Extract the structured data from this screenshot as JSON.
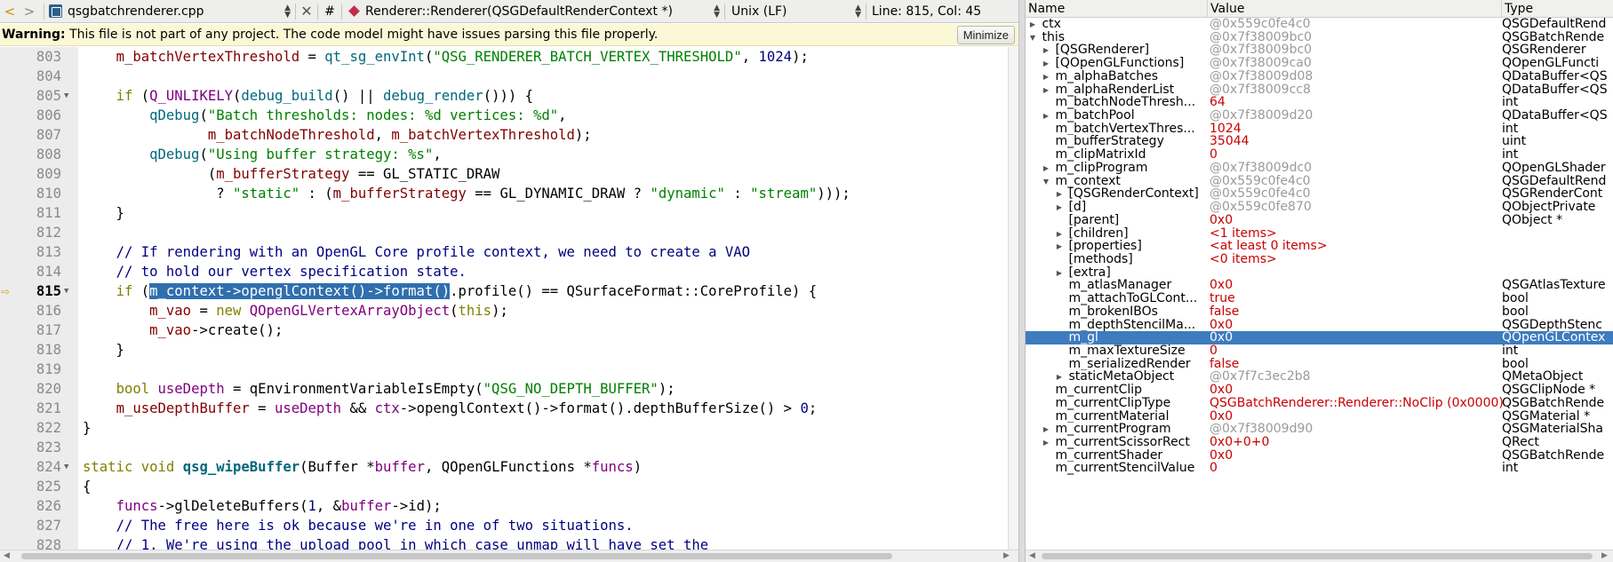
{
  "toolbar": {
    "back_glyph": "<",
    "forward_glyph": ">",
    "file_name": "qsgbatchrenderer.cpp",
    "close_glyph": "✕",
    "hash": "#",
    "symbol": "Renderer::Renderer(QSGDefaultRenderContext *)",
    "line_endings": "Unix (LF)",
    "position": "Line: 815, Col: 45"
  },
  "warning": {
    "label": "Warning:",
    "message": " This file is not part of any project. The code model might have issues parsing this file properly.",
    "button": "Minimize"
  },
  "code_lines": [
    {
      "num": "803",
      "fold": false,
      "html": "    <span class=\"mem\">m_batchVertexThreshold</span> = <span class=\"fnm\">qt_sg_envInt</span>(<span class=\"str\">\"QSG_RENDERER_BATCH_VERTEX_THRESHOLD\"</span>, <span class=\"num\">1024</span>);"
    },
    {
      "num": "804",
      "fold": false,
      "html": ""
    },
    {
      "num": "805",
      "fold": true,
      "html": "    <span class=\"kw\">if</span> (<span class=\"cls\">Q_UNLIKELY</span>(<span class=\"fnm\">debug_build</span>() || <span class=\"fnm\">debug_render</span>())) {"
    },
    {
      "num": "806",
      "fold": false,
      "html": "        <span class=\"fnm\">qDebug</span>(<span class=\"str\">\"Batch thresholds: nodes: %d vertices: %d\"</span>,"
    },
    {
      "num": "807",
      "fold": false,
      "html": "               <span class=\"mem\">m_batchNodeThreshold</span>, <span class=\"mem\">m_batchVertexThreshold</span>);"
    },
    {
      "num": "808",
      "fold": false,
      "html": "        <span class=\"fnm\">qDebug</span>(<span class=\"str\">\"Using buffer strategy: %s\"</span>,"
    },
    {
      "num": "809",
      "fold": false,
      "html": "               (<span class=\"mem\">m_bufferStrategy</span> == GL_STATIC_DRAW"
    },
    {
      "num": "810",
      "fold": false,
      "html": "                ? <span class=\"str\">\"static\"</span> : (<span class=\"mem\">m_bufferStrategy</span> == GL_DYNAMIC_DRAW ? <span class=\"str\">\"dynamic\"</span> : <span class=\"str\">\"stream\"</span>)));"
    },
    {
      "num": "811",
      "fold": false,
      "html": "    }"
    },
    {
      "num": "812",
      "fold": false,
      "html": ""
    },
    {
      "num": "813",
      "fold": false,
      "html": "    <span class=\"cmt\">// If rendering with an OpenGL Core profile context, we need to create a VAO</span>"
    },
    {
      "num": "814",
      "fold": false,
      "html": "    <span class=\"cmt\">// to hold our vertex specification state.</span>"
    },
    {
      "num": "815",
      "fold": true,
      "current": true,
      "html": "    <span class=\"kw\">if</span> (<span class=\"hl\">m_context-&gt;openglContext()-&gt;format()</span>.profile() == QSurfaceFormat::CoreProfile) {"
    },
    {
      "num": "816",
      "fold": false,
      "html": "        <span class=\"mem\">m_vao</span> = <span class=\"kw\">new</span> <span class=\"cls\">QOpenGLVertexArrayObject</span>(<span class=\"kw\">this</span>);"
    },
    {
      "num": "817",
      "fold": false,
      "html": "        <span class=\"mem\">m_vao</span>-&gt;create();"
    },
    {
      "num": "818",
      "fold": false,
      "html": "    }"
    },
    {
      "num": "819",
      "fold": false,
      "html": ""
    },
    {
      "num": "820",
      "fold": false,
      "html": "    <span class=\"kw\">bool</span> <span class=\"cls\">useDepth</span> = qEnvironmentVariableIsEmpty(<span class=\"str\">\"QSG_NO_DEPTH_BUFFER\"</span>);"
    },
    {
      "num": "821",
      "fold": false,
      "html": "    <span class=\"mem\">m_useDepthBuffer</span> = <span class=\"cls\">useDepth</span> &amp;&amp; <span class=\"cls\">ctx</span>-&gt;openglContext()-&gt;format().depthBufferSize() &gt; <span class=\"num\">0</span>;"
    },
    {
      "num": "822",
      "fold": false,
      "html": "}"
    },
    {
      "num": "823",
      "fold": false,
      "html": ""
    },
    {
      "num": "824",
      "fold": true,
      "html": "<span class=\"kw\">static</span> <span class=\"kw\">void</span> <span class=\"fdef\">qsg_wipeBuffer</span>(Buffer *<span class=\"cls\">buffer</span>, QOpenGLFunctions *<span class=\"cls\">funcs</span>)"
    },
    {
      "num": "825",
      "fold": false,
      "html": "{"
    },
    {
      "num": "826",
      "fold": false,
      "html": "    <span class=\"cls\">funcs</span>-&gt;glDeleteBuffers(<span class=\"num\">1</span>, &amp;<span class=\"cls\">buffer</span>-&gt;id);"
    },
    {
      "num": "827",
      "fold": false,
      "html": "    <span class=\"cmt\">// The free here is ok because we're in one of two situations.</span>"
    },
    {
      "num": "828",
      "fold": false,
      "html": "    <span class=\"cmt\">// 1. We're using the upload pool in which case unmap will have set the</span>"
    }
  ],
  "locals": {
    "columns": [
      "Name",
      "Value",
      "Type"
    ],
    "rows": [
      {
        "indent": 0,
        "exp": "closed",
        "name": "ctx",
        "value": "@0x559c0fe4c0",
        "vc": "gray",
        "type": "QSGDefaultRend"
      },
      {
        "indent": 0,
        "exp": "open",
        "name": "this",
        "value": "@0x7f38009bc0",
        "vc": "gray",
        "type": "QSGBatchRende"
      },
      {
        "indent": 1,
        "exp": "closed",
        "name": "[QSGRenderer]",
        "value": "@0x7f38009bc0",
        "vc": "gray",
        "type": "QSGRenderer"
      },
      {
        "indent": 1,
        "exp": "closed",
        "name": "[QOpenGLFunctions]",
        "value": "@0x7f38009ca0",
        "vc": "gray",
        "type": "QOpenGLFuncti"
      },
      {
        "indent": 1,
        "exp": "closed",
        "name": "m_alphaBatches",
        "value": "@0x7f38009d08",
        "vc": "gray",
        "type": "QDataBuffer<QS"
      },
      {
        "indent": 1,
        "exp": "closed",
        "name": "m_alphaRenderList",
        "value": "@0x7f38009cc8",
        "vc": "gray",
        "type": "QDataBuffer<QS"
      },
      {
        "indent": 1,
        "exp": "none",
        "name": "m_batchNodeThresh...",
        "value": "64",
        "vc": "red",
        "type": "int"
      },
      {
        "indent": 1,
        "exp": "closed",
        "name": "m_batchPool",
        "value": "@0x7f38009d20",
        "vc": "gray",
        "type": "QDataBuffer<QS"
      },
      {
        "indent": 1,
        "exp": "none",
        "name": "m_batchVertexThres...",
        "value": "1024",
        "vc": "red",
        "type": "int"
      },
      {
        "indent": 1,
        "exp": "none",
        "name": "m_bufferStrategy",
        "value": "35044",
        "vc": "red",
        "type": "uint"
      },
      {
        "indent": 1,
        "exp": "none",
        "name": "m_clipMatrixId",
        "value": "0",
        "vc": "red",
        "type": "int"
      },
      {
        "indent": 1,
        "exp": "closed",
        "name": "m_clipProgram",
        "value": "@0x7f38009dc0",
        "vc": "gray",
        "type": "QOpenGLShader"
      },
      {
        "indent": 1,
        "exp": "open",
        "name": "m_context",
        "value": "@0x559c0fe4c0",
        "vc": "gray",
        "type": "QSGDefaultRend"
      },
      {
        "indent": 2,
        "exp": "closed",
        "name": "[QSGRenderContext]",
        "value": "@0x559c0fe4c0",
        "vc": "gray",
        "type": "QSGRenderCont"
      },
      {
        "indent": 2,
        "exp": "closed",
        "name": "[d]",
        "value": "@0x559c0fe870",
        "vc": "gray",
        "type": "QObjectPrivate"
      },
      {
        "indent": 2,
        "exp": "none",
        "name": "[parent]",
        "value": "0x0",
        "vc": "red",
        "type": "QObject *"
      },
      {
        "indent": 2,
        "exp": "closed",
        "name": "[children]",
        "value": "<1 items>",
        "vc": "red",
        "type": ""
      },
      {
        "indent": 2,
        "exp": "closed",
        "name": "[properties]",
        "value": "<at least 0 items>",
        "vc": "red",
        "type": ""
      },
      {
        "indent": 2,
        "exp": "none",
        "name": "[methods]",
        "value": "<0 items>",
        "vc": "red",
        "type": ""
      },
      {
        "indent": 2,
        "exp": "closed",
        "name": "[extra]",
        "value": "",
        "vc": "gray",
        "type": ""
      },
      {
        "indent": 2,
        "exp": "none",
        "name": "m_atlasManager",
        "value": "0x0",
        "vc": "red",
        "type": "QSGAtlasTexture"
      },
      {
        "indent": 2,
        "exp": "none",
        "name": "m_attachToGLCont...",
        "value": "true",
        "vc": "red",
        "type": "bool"
      },
      {
        "indent": 2,
        "exp": "none",
        "name": "m_brokenIBOs",
        "value": "false",
        "vc": "red",
        "type": "bool"
      },
      {
        "indent": 2,
        "exp": "none",
        "name": "m_depthStencilMa...",
        "value": "0x0",
        "vc": "red",
        "type": "QSGDepthStenc"
      },
      {
        "indent": 2,
        "exp": "none",
        "name": "m_gl",
        "value": "0x0",
        "vc": "red",
        "type": "QOpenGLContex",
        "selected": true
      },
      {
        "indent": 2,
        "exp": "none",
        "name": "m_maxTextureSize",
        "value": "0",
        "vc": "red",
        "type": "int"
      },
      {
        "indent": 2,
        "exp": "none",
        "name": "m_serializedRender",
        "value": "false",
        "vc": "red",
        "type": "bool"
      },
      {
        "indent": 2,
        "exp": "closed",
        "name": "staticMetaObject",
        "value": "@0x7f7c3ec2b8",
        "vc": "gray",
        "type": "QMetaObject"
      },
      {
        "indent": 1,
        "exp": "none",
        "name": "m_currentClip",
        "value": "0x0",
        "vc": "red",
        "type": "QSGClipNode *"
      },
      {
        "indent": 1,
        "exp": "none",
        "name": "m_currentClipType",
        "value": "QSGBatchRenderer::Renderer::NoClip (0x0000)",
        "vc": "red",
        "type": "QSGBatchRende"
      },
      {
        "indent": 1,
        "exp": "none",
        "name": "m_currentMaterial",
        "value": "0x0",
        "vc": "red",
        "type": "QSGMaterial *"
      },
      {
        "indent": 1,
        "exp": "closed",
        "name": "m_currentProgram",
        "value": "@0x7f38009d90",
        "vc": "gray",
        "type": "QSGMaterialSha"
      },
      {
        "indent": 1,
        "exp": "closed",
        "name": "m_currentScissorRect",
        "value": "0x0+0+0",
        "vc": "red",
        "type": "QRect"
      },
      {
        "indent": 1,
        "exp": "none",
        "name": "m_currentShader",
        "value": "0x0",
        "vc": "red",
        "type": "QSGBatchRende"
      },
      {
        "indent": 1,
        "exp": "none",
        "name": "m_currentStencilValue",
        "value": "0",
        "vc": "red",
        "type": "int"
      }
    ]
  }
}
